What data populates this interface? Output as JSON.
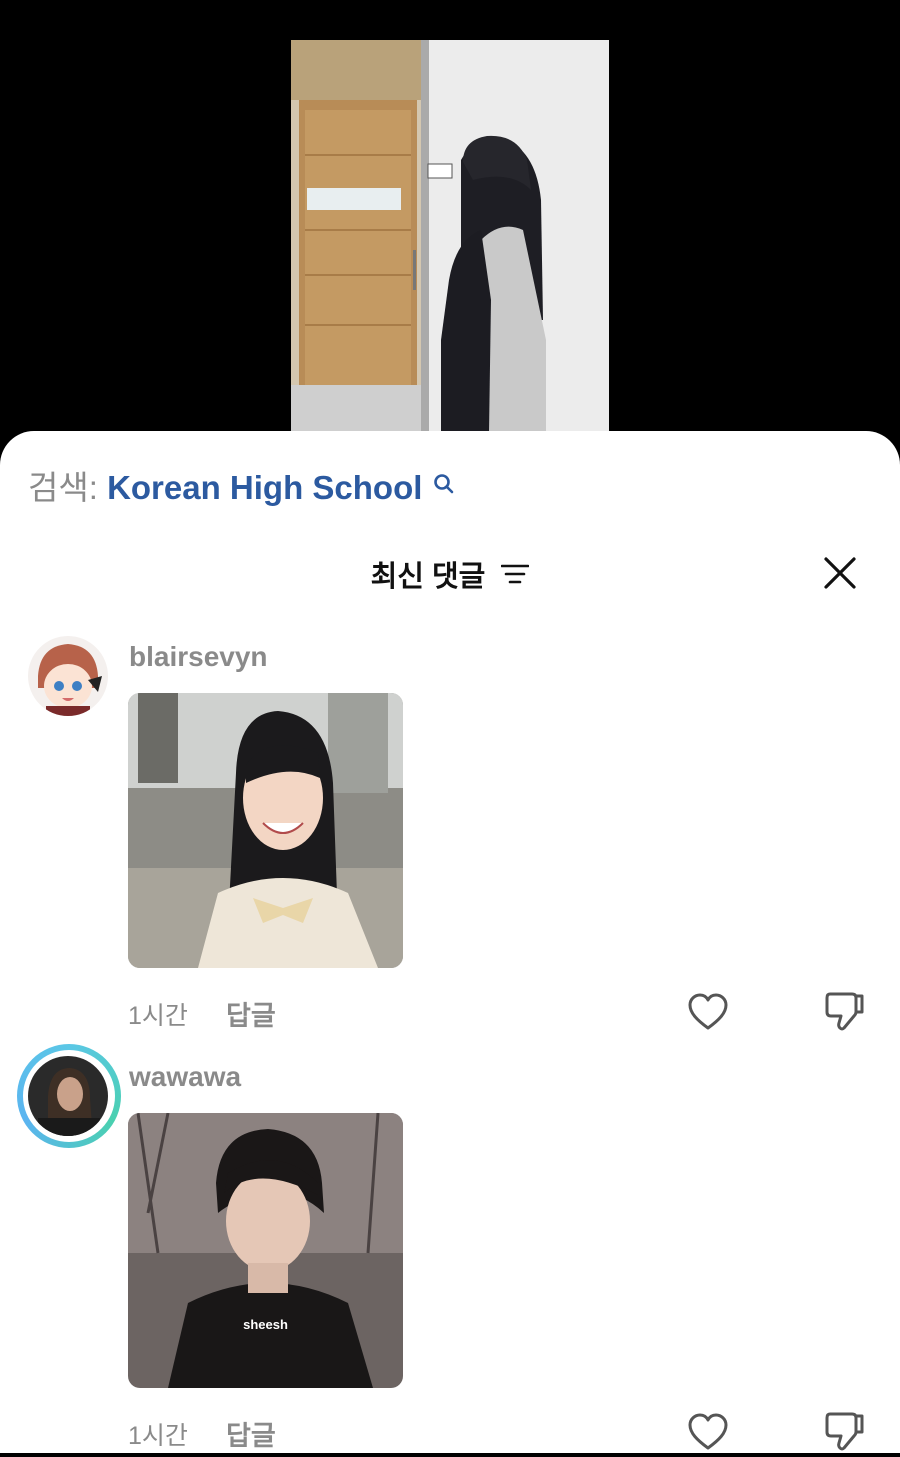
{
  "search": {
    "prefix": "검색:",
    "term": "Korean High School"
  },
  "comments_header": {
    "title": "최신 댓글"
  },
  "comments": [
    {
      "username": "blairsevyn",
      "time": "1시간",
      "reply_label": "답글"
    },
    {
      "username": "wawawa",
      "time": "1시간",
      "reply_label": "답글",
      "image_caption": "sheesh"
    }
  ],
  "icons": {
    "search": "search-icon",
    "sort": "sort-icon",
    "close": "close-icon",
    "like": "heart-icon",
    "dislike": "thumbs-down-icon"
  },
  "colors": {
    "link": "#2c5aa0",
    "muted": "#8a8a8a",
    "avatar_ring": "#5bc7e6"
  }
}
